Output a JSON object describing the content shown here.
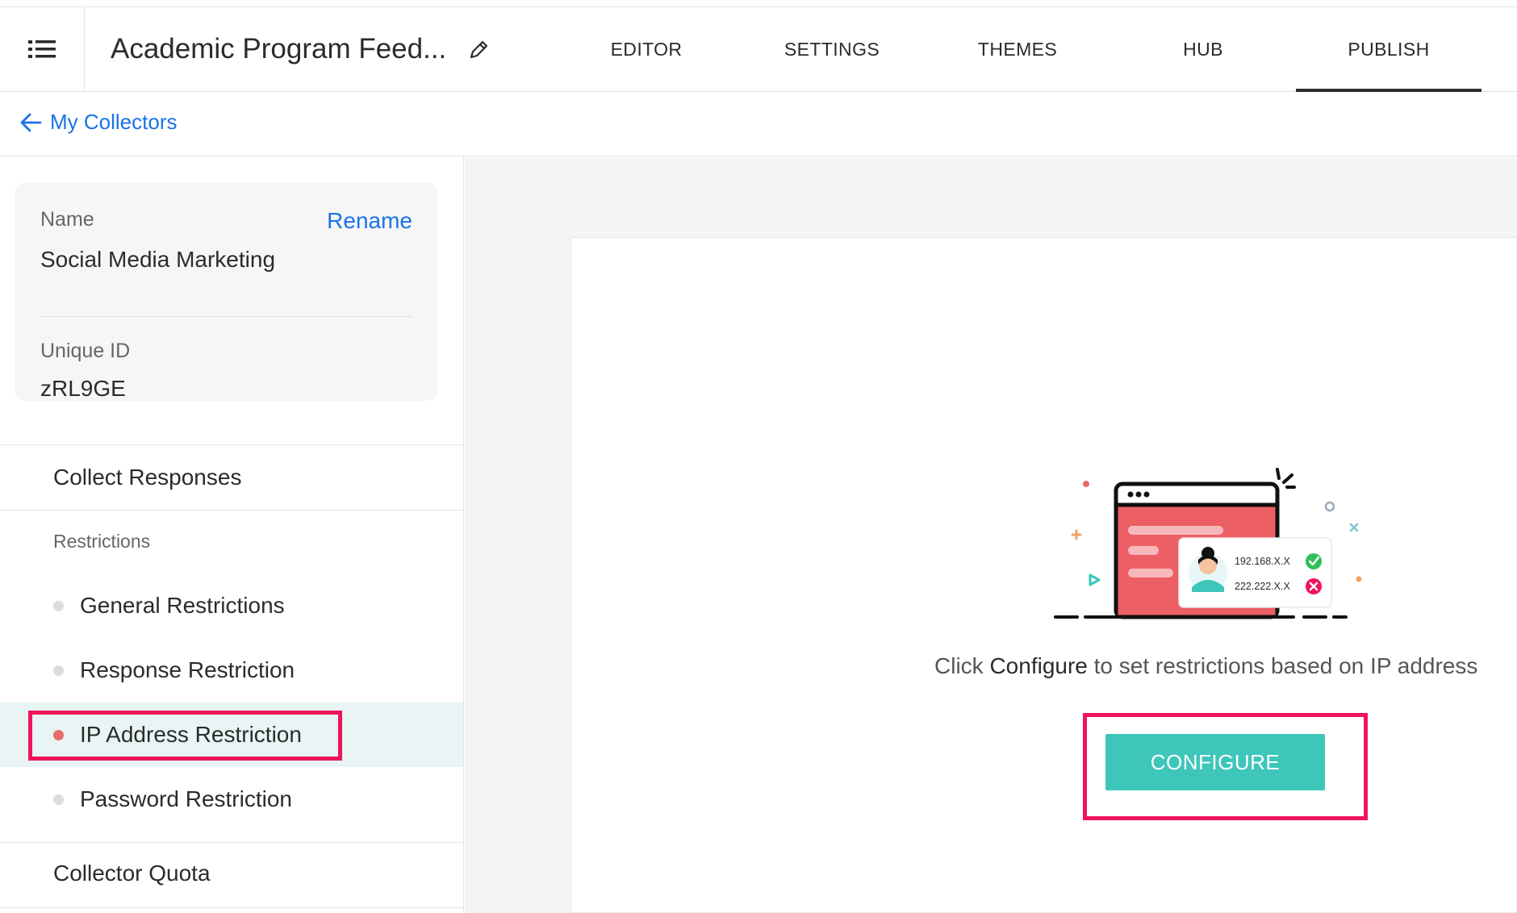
{
  "header": {
    "survey_title": "Academic Program Feed...",
    "tabs": [
      {
        "label": "EDITOR"
      },
      {
        "label": "SETTINGS"
      },
      {
        "label": "THEMES"
      },
      {
        "label": "HUB"
      },
      {
        "label": "PUBLISH"
      }
    ],
    "active_tab": "PUBLISH"
  },
  "subbar": {
    "back_label": "My Collectors"
  },
  "collector": {
    "name_label": "Name",
    "name_value": "Social Media Marketing",
    "rename_label": "Rename",
    "uid_label": "Unique ID",
    "uid_value": "zRL9GE"
  },
  "sidebar": {
    "collect_responses": "Collect Responses",
    "restrictions_heading": "Restrictions",
    "restrictions": [
      {
        "label": "General Restrictions",
        "active": false
      },
      {
        "label": "Response Restriction",
        "active": false
      },
      {
        "label": "IP Address Restriction",
        "active": true
      },
      {
        "label": "Password Restriction",
        "active": false
      }
    ],
    "collector_quota": "Collector Quota"
  },
  "main": {
    "illustration": {
      "ip_allowed": "192.168.X.X",
      "ip_blocked": "222.222.X.X"
    },
    "desc_prefix": "Click ",
    "desc_bold": "Configure",
    "desc_suffix": " to set restrictions based on IP address",
    "configure_label": "CONFIGURE"
  },
  "colors": {
    "accent_teal": "#3ec6bb",
    "link_blue": "#1a73e8",
    "highlight_red": "#f0145a"
  }
}
